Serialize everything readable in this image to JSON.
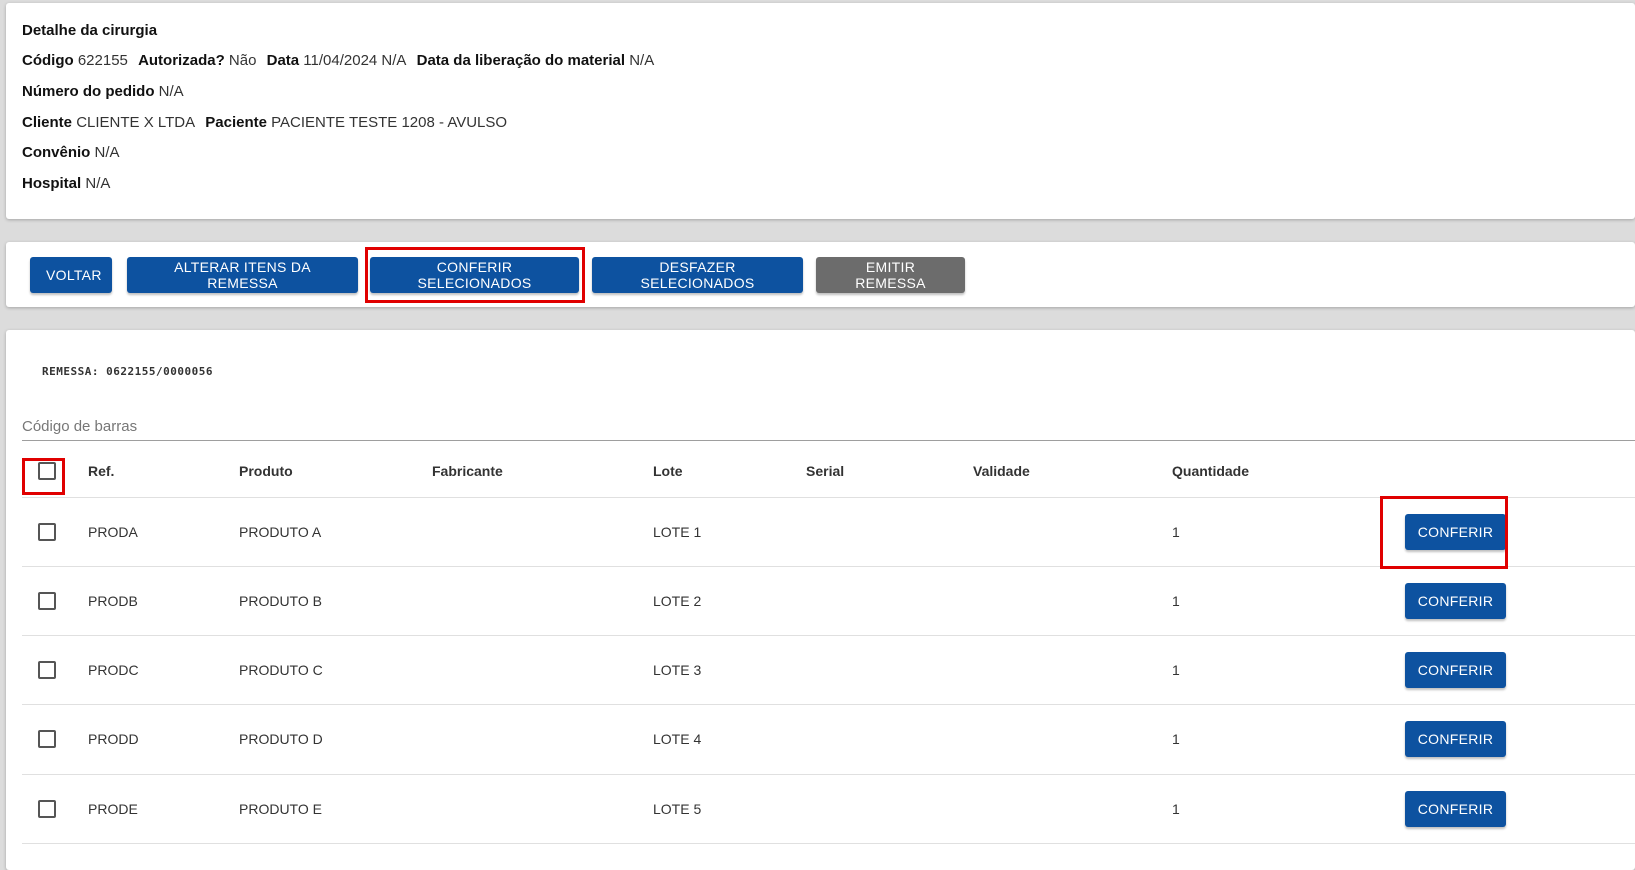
{
  "detail": {
    "title": "Detalhe da cirurgia",
    "codigo_label": "Código",
    "codigo_value": "622155",
    "autorizada_label": "Autorizada?",
    "autorizada_value": "Não",
    "data_label": "Data",
    "data_value": "11/04/2024 N/A",
    "liberacao_label": "Data da liberação do material",
    "liberacao_value": "N/A",
    "pedido_label": "Número do pedido",
    "pedido_value": "N/A",
    "cliente_label": "Cliente",
    "cliente_value": "CLIENTE X LTDA",
    "paciente_label": "Paciente",
    "paciente_value": "PACIENTE TESTE 1208 - AVULSO",
    "convenio_label": "Convênio",
    "convenio_value": "N/A",
    "hospital_label": "Hospital",
    "hospital_value": "N/A"
  },
  "actions": {
    "voltar": "VOLTAR",
    "alterar": "ALTERAR ITENS DA REMESSA",
    "conferir_selecionados": "CONFERIR SELECIONADOS",
    "desfazer_selecionados": "DESFAZER SELECIONADOS",
    "emitir_remessa": "EMITIR REMESSA"
  },
  "remessa": {
    "label": "REMESSA: 0622155/0000056",
    "barcode_placeholder": "Código de barras"
  },
  "table": {
    "headers": {
      "ref": "Ref.",
      "produto": "Produto",
      "fabricante": "Fabricante",
      "lote": "Lote",
      "serial": "Serial",
      "validade": "Validade",
      "quantidade": "Quantidade"
    },
    "rows": [
      {
        "ref": "PRODA",
        "produto": "PRODUTO A",
        "fabricante": "",
        "lote": "LOTE 1",
        "serial": "",
        "validade": "",
        "quantidade": "1",
        "action": "CONFERIR"
      },
      {
        "ref": "PRODB",
        "produto": "PRODUTO B",
        "fabricante": "",
        "lote": "LOTE 2",
        "serial": "",
        "validade": "",
        "quantidade": "1",
        "action": "CONFERIR"
      },
      {
        "ref": "PRODC",
        "produto": "PRODUTO C",
        "fabricante": "",
        "lote": "LOTE 3",
        "serial": "",
        "validade": "",
        "quantidade": "1",
        "action": "CONFERIR"
      },
      {
        "ref": "PRODD",
        "produto": "PRODUTO D",
        "fabricante": "",
        "lote": "LOTE 4",
        "serial": "",
        "validade": "",
        "quantidade": "1",
        "action": "CONFERIR"
      },
      {
        "ref": "PRODE",
        "produto": "PRODUTO E",
        "fabricante": "",
        "lote": "LOTE 5",
        "serial": "",
        "validade": "",
        "quantidade": "1",
        "action": "CONFERIR"
      }
    ]
  },
  "colors": {
    "primary_button": "#0d52a0",
    "disabled_button": "#6c6c6c",
    "highlight": "#e00000"
  }
}
